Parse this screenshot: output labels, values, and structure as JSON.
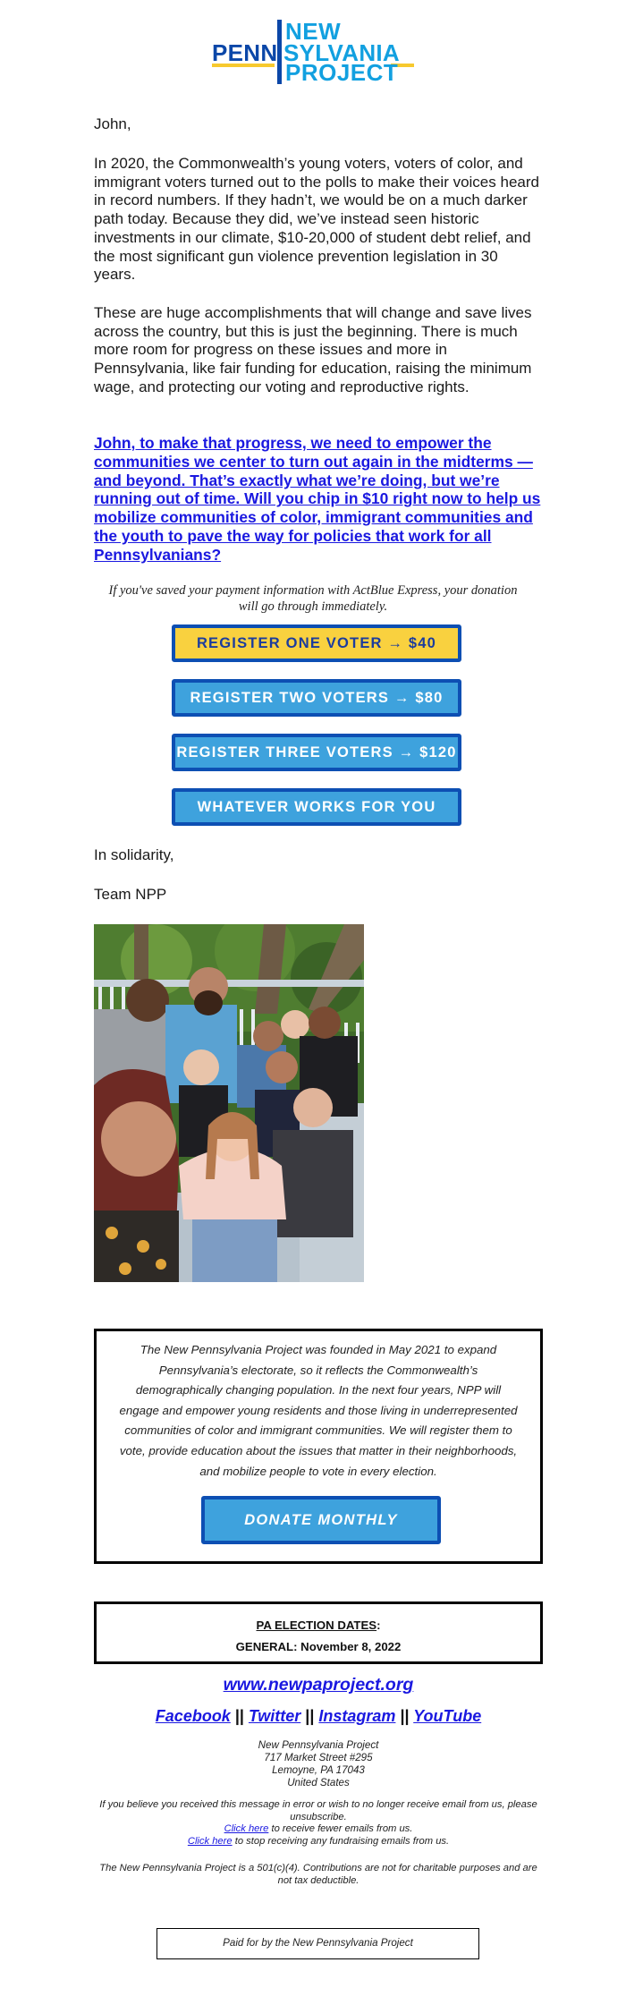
{
  "logo": {
    "line1": "NEW",
    "line2a": "PENN",
    "line2b": "SYLVANIA",
    "line3": "PROJECT",
    "colors": {
      "dark_blue": "#0b47a8",
      "light_blue": "#12a0e0",
      "yellow": "#f7c92e"
    }
  },
  "greeting": "John,",
  "paragraphs": [
    "In 2020, the Commonwealth’s young voters, voters of color, and immigrant voters turned out to the polls to make their voices heard in record numbers. If they hadn’t, we would be on a much darker path today. Because they did, we’ve instead seen historic investments in our climate, $10-20,000 of student debt relief, and the most significant gun violence prevention legislation in 30 years.",
    "These are huge accomplishments that will change and save lives across the country, but this is just the beginning. There is much more room for progress on these issues and more in Pennsylvania, like fair funding for education, raising the minimum wage, and protecting our voting and reproductive rights."
  ],
  "cta_link": "John, to make that progress, we need to empower the communities we center to turn out again in the midterms — and beyond. That’s exactly what we’re doing, but we’re running out of time. Will you chip in $10 right now to help us mobilize communities of color, immigrant communities and the youth to pave the way for policies that work for all Pennsylvanians?",
  "actblue_note": "If you've saved your payment information with ActBlue Express, your donation will go through immediately.",
  "donate_buttons": [
    {
      "label": "REGISTER ONE VOTER → $40",
      "style": "yellow"
    },
    {
      "label": "REGISTER TWO VOTERS → $80",
      "style": "blue"
    },
    {
      "label": "REGISTER THREE VOTERS → $120",
      "style": "blue"
    },
    {
      "label": "WHATEVER WORKS FOR YOU",
      "style": "blue"
    }
  ],
  "signoff": "In solidarity,",
  "signature": "Team NPP",
  "photo": {
    "alt": "Group selfie of New Pennsylvania Project team members on a deck"
  },
  "about": {
    "text": "The New Pennsylvania Project was founded in May 2021 to expand Pennsylvania’s electorate, so it reflects the Commonwealth’s demographically changing population. In the next four years, NPP will engage and empower young residents and those living in underrepresented communities of color and immigrant communities. We will register them to vote, provide education about the issues that matter in their neighborhoods, and mobilize people to vote in every election.",
    "button_label": "DONATE MONTHLY"
  },
  "election": {
    "heading": "PA ELECTION DATES",
    "heading_suffix": ":",
    "general": "GENERAL: November 8, 2022"
  },
  "website": "www.newpaproject.org",
  "social": {
    "links": [
      "Facebook",
      "Twitter",
      "Instagram",
      "YouTube"
    ],
    "separator": "||"
  },
  "address": {
    "org": "New Pennsylvania Project",
    "street": "717 Market Street #295",
    "city": "Lemoyne, PA 17043",
    "country": "United States"
  },
  "unsubscribe": {
    "line1": "If you believe you received this message in error or wish to no longer receive email from us, please unsubscribe.",
    "fewer_link": "Click here",
    "fewer_text": " to receive fewer emails from us.",
    "stop_link": "Click here",
    "stop_text": " to stop receiving any fundraising emails from us."
  },
  "disclaimer": "The New Pennsylvania Project is a 501(c)(4). Contributions are not for charitable purposes and are not tax deductible.",
  "paid_for": "Paid for by the New Pennsylvania Project",
  "colors": {
    "link": "#1a18e0",
    "button_border": "#0d4fb3",
    "button_yellow": "#f9d13f",
    "button_blue": "#3ea2dd"
  }
}
